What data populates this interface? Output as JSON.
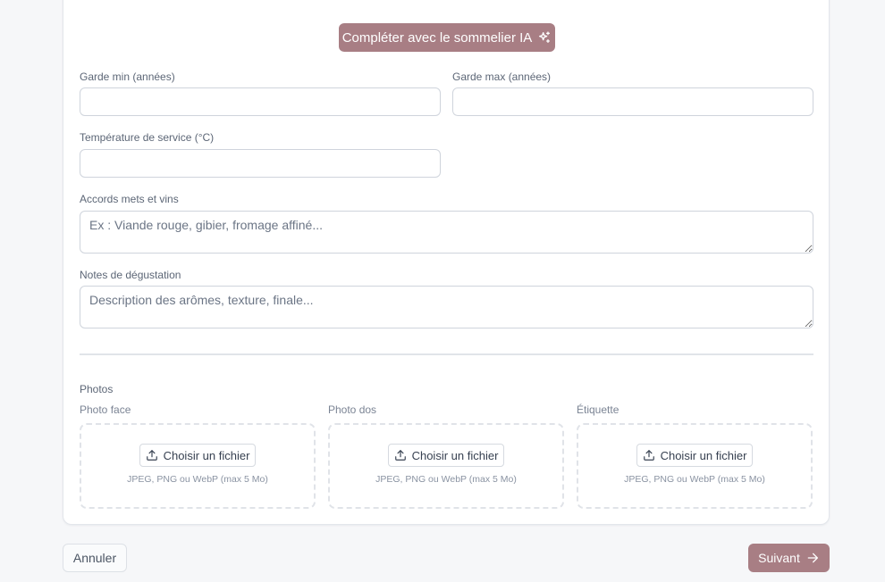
{
  "ai_button": {
    "label": "Compléter avec le sommelier IA",
    "icon": "sparkles-icon"
  },
  "fields": {
    "garde_min": {
      "label": "Garde min (années)",
      "value": ""
    },
    "garde_max": {
      "label": "Garde max (années)",
      "value": ""
    },
    "temperature": {
      "label": "Température de service (°C)",
      "value": ""
    },
    "accords": {
      "label": "Accords mets et vins",
      "placeholder": "Ex : Viande rouge, gibier, fromage affiné..."
    },
    "notes": {
      "label": "Notes de dégustation",
      "placeholder": "Description des arômes, texture, finale..."
    }
  },
  "photos": {
    "title": "Photos",
    "uploads": [
      {
        "label": "Photo face",
        "button": "Choisir un fichier",
        "hint": "JPEG, PNG ou WebP (max 5 Mo)"
      },
      {
        "label": "Photo dos",
        "button": "Choisir un fichier",
        "hint": "JPEG, PNG ou WebP (max 5 Mo)"
      },
      {
        "label": "Étiquette",
        "button": "Choisir un fichier",
        "hint": "JPEG, PNG ou WebP (max 5 Mo)"
      }
    ]
  },
  "footer": {
    "cancel": "Annuler",
    "next": "Suivant"
  },
  "colors": {
    "accent": "#a87e84",
    "background": "#f6f7f9",
    "card": "#ffffff"
  }
}
